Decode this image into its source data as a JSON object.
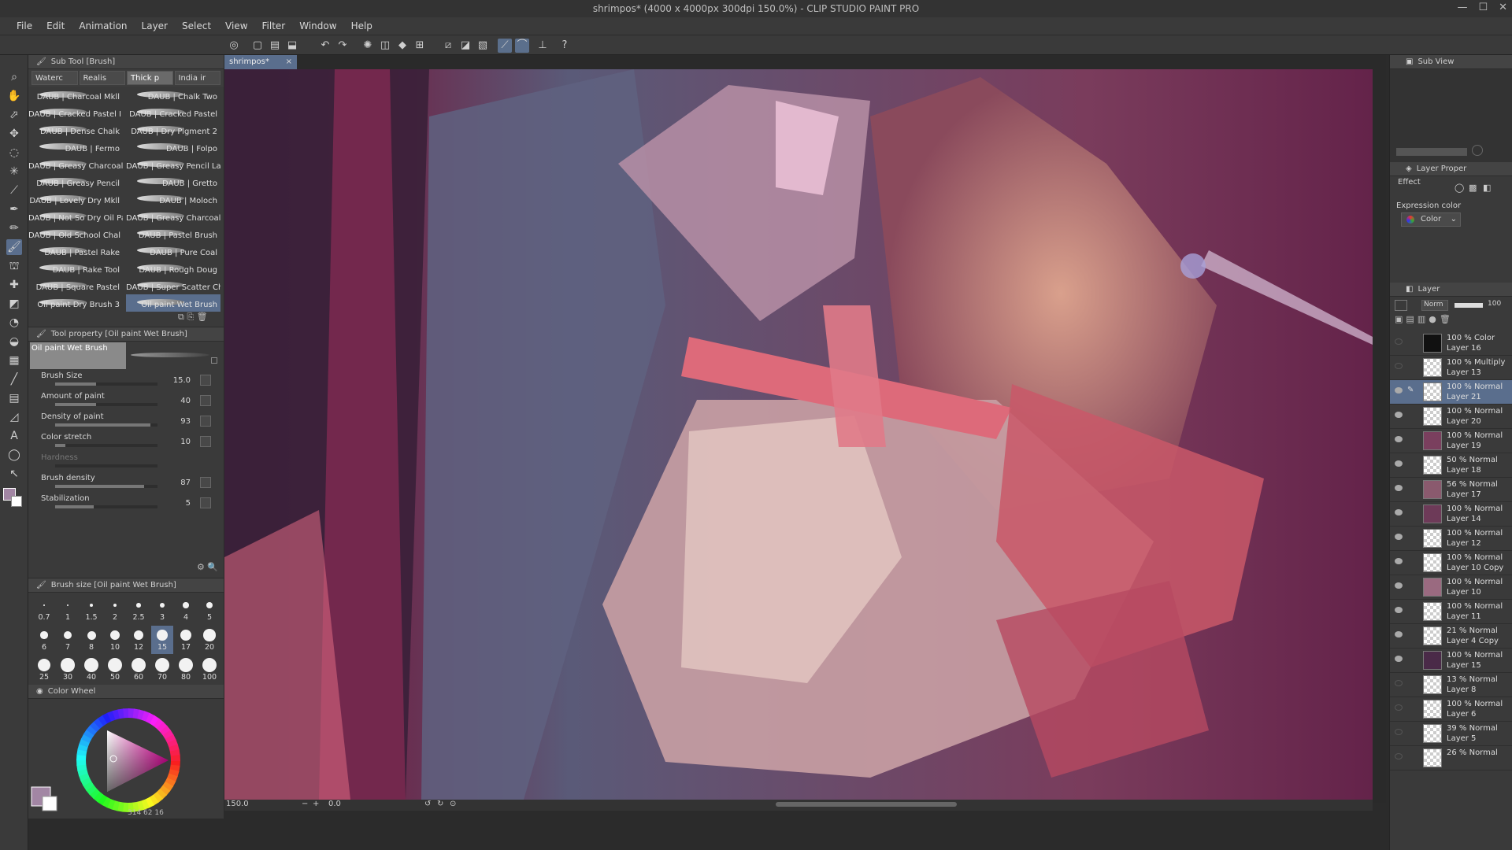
{
  "window": {
    "title": "shrimpos* (4000 x 4000px 300dpi 150.0%)  - CLIP STUDIO PAINT PRO",
    "controls": [
      "—",
      "☐",
      "✕"
    ]
  },
  "menu": [
    "File",
    "Edit",
    "Animation",
    "Layer",
    "Select",
    "View",
    "Filter",
    "Window",
    "Help"
  ],
  "subtool": {
    "header": "Sub Tool [Brush]",
    "tabs": [
      "Waterc",
      "Realis",
      "Thick p",
      "India ir"
    ],
    "brushes": [
      [
        "DAUB | Charcoal Mkll",
        "DAUB | Chalk Two"
      ],
      [
        "DAUB | Cracked Pastel I",
        "DAUB | Cracked Pastel"
      ],
      [
        "DAUB | Dense Chalk",
        "DAUB | Dry Pigment 2"
      ],
      [
        "DAUB | Fermo",
        "DAUB | Folpo"
      ],
      [
        "DAUB | Greasy Charcoal",
        "DAUB | Greasy Pencil Lar"
      ],
      [
        "DAUB | Greasy Pencil",
        "DAUB | Gretto"
      ],
      [
        "DAUB | Lovely Dry Mkll",
        "DAUB | Moloch"
      ],
      [
        "DAUB | Not So Dry Oil Pa",
        "DAUB | Greasy Charcoal"
      ],
      [
        "DAUB | Old School Chal",
        "DAUB | Pastel Brush"
      ],
      [
        "DAUB | Pastel Rake",
        "DAUB | Pure Coal"
      ],
      [
        "DAUB | Rake Tool",
        "DAUB | Rough Doug"
      ],
      [
        "DAUB | Square Pastel",
        "DAUB | Super Scatter Ch"
      ],
      [
        "Oil paint Dry Brush 3",
        "Oil paint Wet Brush"
      ]
    ]
  },
  "toolprop": {
    "header": "Tool property [Oil paint Wet Brush]",
    "brush_name": "Oil paint Wet Brush",
    "rows": [
      {
        "label": "Brush Size",
        "value": "15.0",
        "pct": 0.4
      },
      {
        "label": "Amount of paint",
        "value": "40",
        "pct": 0.4
      },
      {
        "label": "Density of paint",
        "value": "93",
        "pct": 0.93
      },
      {
        "label": "Color stretch",
        "value": "10",
        "pct": 0.1
      },
      {
        "label": "Hardness",
        "value": "",
        "pct": 0
      },
      {
        "label": "Brush density",
        "value": "87",
        "pct": 0.87
      },
      {
        "label": "Stabilization",
        "value": "5",
        "pct": 0.38
      }
    ]
  },
  "brushsize": {
    "header": "Brush size [Oil paint Wet Brush]",
    "sizes": [
      "0.7",
      "1",
      "1.5",
      "2",
      "2.5",
      "3",
      "4",
      "5",
      "6",
      "7",
      "8",
      "10",
      "12",
      "15",
      "17",
      "20",
      "25",
      "30",
      "40",
      "50",
      "60",
      "70",
      "80",
      "100"
    ],
    "selected": "15"
  },
  "colorwheel": {
    "header": "Color Wheel",
    "main_color": "#a286a4",
    "sub_color": "#ffffff",
    "readout": "314  62  16"
  },
  "doc": {
    "tab": "shrimpos*",
    "zoom": "150.0",
    "angle": "0.0"
  },
  "right": {
    "subview": "Sub View",
    "layer_property": "Layer Proper",
    "effect": "Effect",
    "expression_color_label": "Expression color",
    "expression_color_value": "Color",
    "layer_header": "Layer",
    "blend": "Norm",
    "opacity": "100"
  },
  "layers": [
    {
      "mode": "100 % Color",
      "name": "Layer 16",
      "visible": false,
      "thumb": "#111111"
    },
    {
      "mode": "100 % Multiply",
      "name": "Layer 13",
      "visible": false,
      "thumb": "checker"
    },
    {
      "mode": "100 % Normal",
      "name": "Layer 21",
      "visible": true,
      "thumb": "checker"
    },
    {
      "mode": "100 % Normal",
      "name": "Layer 20",
      "visible": true,
      "thumb": "checker"
    },
    {
      "mode": "100 % Normal",
      "name": "Layer 19",
      "visible": true,
      "thumb": "#7a3f5e"
    },
    {
      "mode": "50 % Normal",
      "name": "Layer 18",
      "visible": true,
      "thumb": "checker"
    },
    {
      "mode": "56 % Normal",
      "name": "Layer 17",
      "visible": true,
      "thumb": "#8a5a6e"
    },
    {
      "mode": "100 % Normal",
      "name": "Layer 14",
      "visible": true,
      "thumb": "#6d3a58"
    },
    {
      "mode": "100 % Normal",
      "name": "Layer 12",
      "visible": true,
      "thumb": "checker"
    },
    {
      "mode": "100 % Normal",
      "name": "Layer 10 Copy",
      "visible": true,
      "thumb": "checker"
    },
    {
      "mode": "100 % Normal",
      "name": "Layer 10",
      "visible": true,
      "thumb": "#9a6a80"
    },
    {
      "mode": "100 % Normal",
      "name": "Layer 11",
      "visible": true,
      "thumb": "checker"
    },
    {
      "mode": "21 % Normal",
      "name": "Layer 4 Copy",
      "visible": true,
      "thumb": "checker"
    },
    {
      "mode": "100 % Normal",
      "name": "Layer 15",
      "visible": true,
      "thumb": "#4a2a48"
    },
    {
      "mode": "13 % Normal",
      "name": "Layer 8",
      "visible": false,
      "thumb": "checker"
    },
    {
      "mode": "100 % Normal",
      "name": "Layer 6",
      "visible": false,
      "thumb": "checker"
    },
    {
      "mode": "39 % Normal",
      "name": "Layer 5",
      "visible": false,
      "thumb": "checker"
    },
    {
      "mode": "26 % Normal",
      "name": "",
      "visible": false,
      "thumb": "checker"
    }
  ],
  "selected_layer": "Layer 21"
}
